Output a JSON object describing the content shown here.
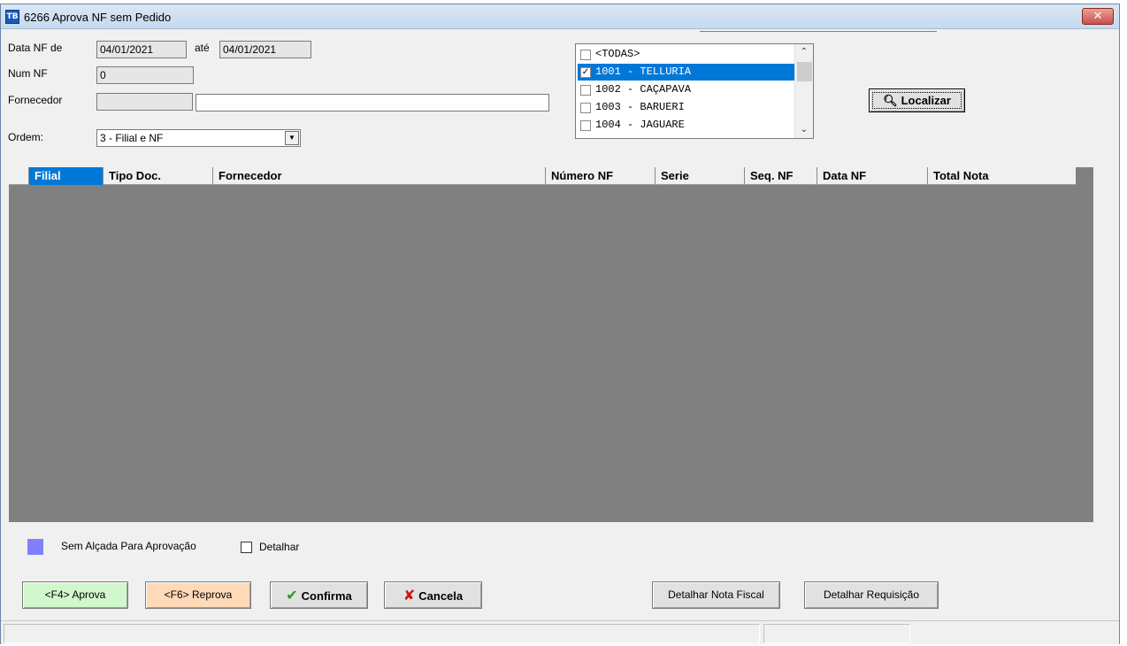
{
  "window": {
    "app_icon": "TB",
    "title": "6266 Aprova NF sem Pedido",
    "close_label": "✕"
  },
  "filters": {
    "data_nf_label": "Data NF de",
    "data_nf_from": "04/01/2021",
    "ate_label": "até",
    "data_nf_to": "04/01/2021",
    "num_nf_label": "Num NF",
    "num_nf_value": "0",
    "fornecedor_label": "Fornecedor",
    "fornecedor_code": "",
    "fornecedor_name": "",
    "ordem_label": "Ordem:",
    "ordem_value": "3 - Filial e NF"
  },
  "filial_list": {
    "items": [
      {
        "label": "<TODAS>",
        "checked": false,
        "selected": false
      },
      {
        "label": "1001 - TELLURIA",
        "checked": true,
        "selected": true
      },
      {
        "label": "1002 - CAÇAPAVA",
        "checked": false,
        "selected": false
      },
      {
        "label": "1003 - BARUERI",
        "checked": false,
        "selected": false
      },
      {
        "label": "1004 - JAGUARE",
        "checked": false,
        "selected": false
      }
    ]
  },
  "toolbar": {
    "localizar_label": "Localizar",
    "localizar_icon": "search-doc-icon"
  },
  "grid": {
    "columns": [
      "Filial",
      "Tipo Doc.",
      "Fornecedor",
      "Número NF",
      "Serie",
      "Seq. NF",
      "Data NF",
      "Total Nota"
    ],
    "rows": []
  },
  "legend": {
    "label": "Sem Alçada Para Aprovação",
    "color": "#8080ff"
  },
  "detalhar": {
    "label": "Detalhar",
    "checked": false
  },
  "buttons": {
    "aprova": "<F4> Aprova",
    "reprova": "<F6> Reprova",
    "confirma": "Confirma",
    "cancela": "Cancela",
    "detalhar_nf": "Detalhar Nota Fiscal",
    "detalhar_req": "Detalhar Requisição"
  },
  "colors": {
    "aprova_bg": "#d0f8cc",
    "reprova_bg": "#ffd9b8",
    "selection": "#0078d7",
    "grid_bg": "#808080"
  }
}
